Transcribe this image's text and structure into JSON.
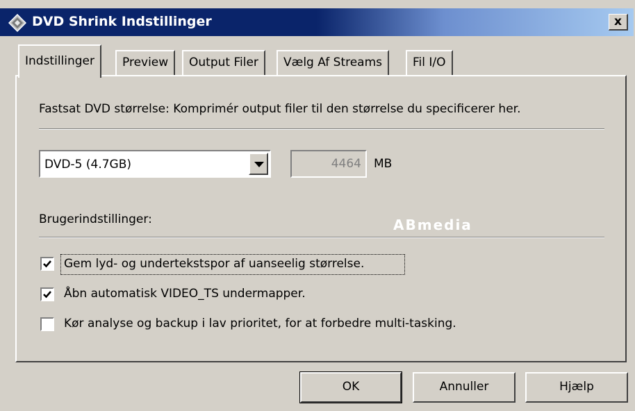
{
  "window": {
    "title": "DVD Shrink Indstillinger",
    "close_glyph": "x",
    "icon": "dvd-shrink-app-icon"
  },
  "tabs": [
    {
      "label": "Indstillinger",
      "active": true
    },
    {
      "label": "Preview",
      "active": false
    },
    {
      "label": "Output Filer",
      "active": false
    },
    {
      "label": "Vælg Af Streams",
      "active": false
    },
    {
      "label": "Fil I/O",
      "active": false
    }
  ],
  "settings": {
    "description": "Fastsat DVD størrelse: Komprimér output filer til den størrelse du specificerer her.",
    "dvd_size_selected": "DVD-5 (4.7GB)",
    "size_value": "4464",
    "size_unit": "MB",
    "user_settings_label": "Brugerindstillinger:",
    "watermark": "ABmedia",
    "options": [
      {
        "label": "Gem lyd- og undertekstspor af uanseelig størrelse.",
        "checked": true
      },
      {
        "label": "Åbn automatisk VIDEO_TS undermapper.",
        "checked": true
      },
      {
        "label": "Kør analyse og backup i lav prioritet, for at forbedre multi-tasking.",
        "checked": false
      }
    ]
  },
  "buttons": {
    "ok": "OK",
    "cancel": "Annuller",
    "help": "Hjælp"
  },
  "colors": {
    "face": "#d4d0c8",
    "title_active": "#0a246a",
    "title_gradient_end": "#a6caf0"
  }
}
